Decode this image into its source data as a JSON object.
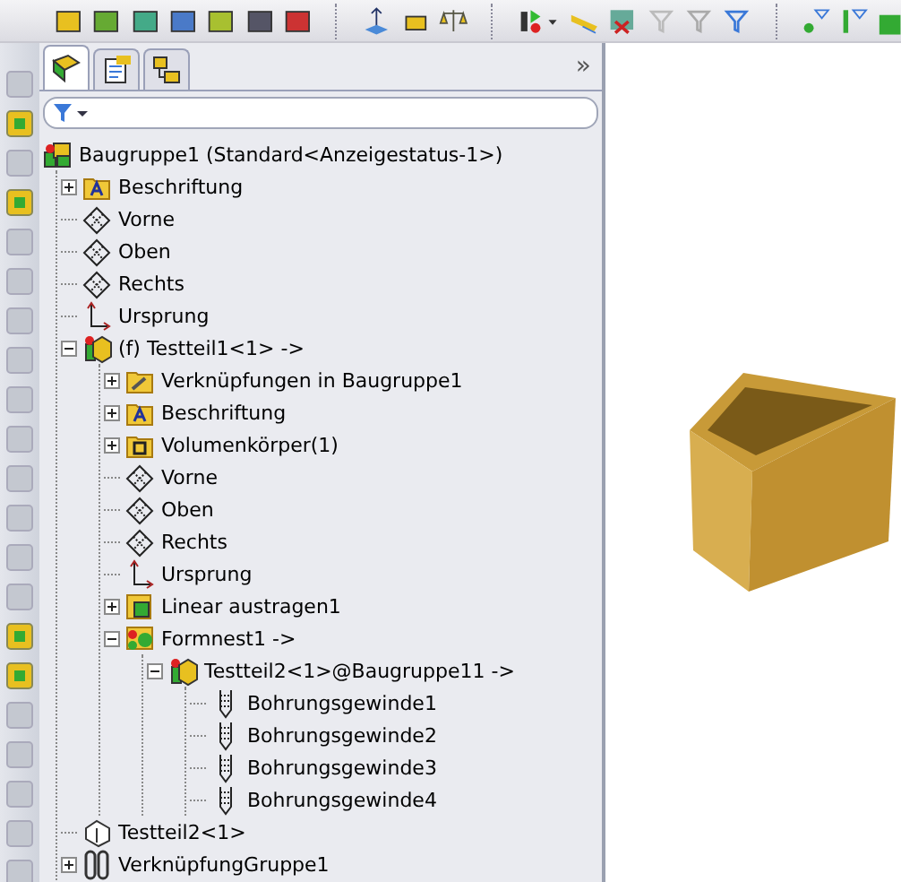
{
  "panel": {
    "tabs": [
      {
        "kind": "feature-tree",
        "selected": true
      },
      {
        "kind": "properties",
        "selected": false
      },
      {
        "kind": "configurations",
        "selected": false
      }
    ],
    "collapse_glyph": "»"
  },
  "tree": {
    "label": "Baugruppe1  (Standard<Anzeigestatus-1>)",
    "kind": "assembly",
    "children": [
      {
        "label": "Beschriftung",
        "kind": "annotations",
        "expanded": false
      },
      {
        "label": "Vorne",
        "kind": "plane"
      },
      {
        "label": "Oben",
        "kind": "plane"
      },
      {
        "label": "Rechts",
        "kind": "plane"
      },
      {
        "label": "Ursprung",
        "kind": "origin"
      },
      {
        "label": "(f) Testteil1<1> ->",
        "kind": "part",
        "expanded": true,
        "children": [
          {
            "label": "Verknüpfungen in Baugruppe1",
            "kind": "mates-folder",
            "expanded": false
          },
          {
            "label": "Beschriftung",
            "kind": "annotations",
            "expanded": false
          },
          {
            "label": "Volumenkörper(1)",
            "kind": "solids",
            "expanded": false
          },
          {
            "label": "Vorne",
            "kind": "plane"
          },
          {
            "label": "Oben",
            "kind": "plane"
          },
          {
            "label": "Rechts",
            "kind": "plane"
          },
          {
            "label": "Ursprung",
            "kind": "origin"
          },
          {
            "label": "Linear austragen1",
            "kind": "feature",
            "expanded": false
          },
          {
            "label": "Formnest1 ->",
            "kind": "cavity",
            "expanded": true,
            "children": [
              {
                "label": "Testteil2<1>@Baugruppe11 ->",
                "kind": "part",
                "expanded": true,
                "children": [
                  {
                    "label": "Bohrungsgewinde1",
                    "kind": "thread"
                  },
                  {
                    "label": "Bohrungsgewinde2",
                    "kind": "thread"
                  },
                  {
                    "label": "Bohrungsgewinde3",
                    "kind": "thread"
                  },
                  {
                    "label": "Bohrungsgewinde4",
                    "kind": "thread"
                  }
                ]
              }
            ]
          }
        ]
      },
      {
        "label": "Testteil2<1>",
        "kind": "suppressed-part"
      },
      {
        "label": "VerknüpfungGruppe1",
        "kind": "mate-group",
        "expanded": false
      }
    ]
  }
}
